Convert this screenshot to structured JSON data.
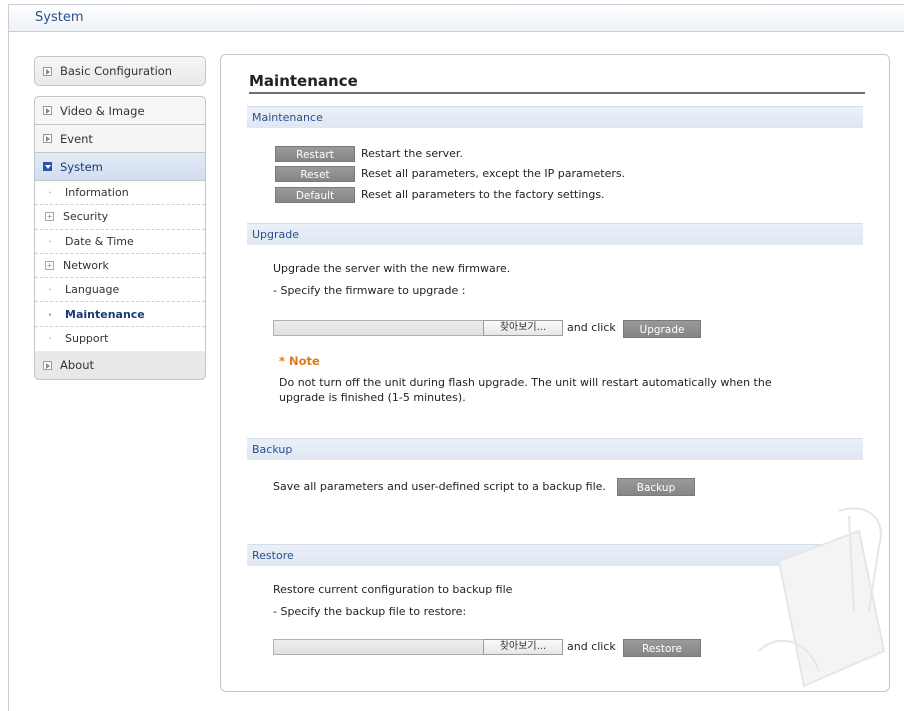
{
  "header": {
    "title": "System"
  },
  "sidebar": {
    "basic_configuration": "Basic Configuration",
    "video_image": "Video & Image",
    "event": "Event",
    "system": "System",
    "system_items": [
      {
        "label": "Information",
        "marker": "dot"
      },
      {
        "label": "Security",
        "marker": "plus"
      },
      {
        "label": "Date & Time",
        "marker": "dot"
      },
      {
        "label": "Network",
        "marker": "plus"
      },
      {
        "label": "Language",
        "marker": "dot"
      },
      {
        "label": "Maintenance",
        "marker": "dot",
        "current": true
      },
      {
        "label": "Support",
        "marker": "dot"
      }
    ],
    "about": "About"
  },
  "main": {
    "title": "Maintenance",
    "maintenance": {
      "header": "Maintenance",
      "restart_btn": "Restart",
      "restart_desc": "Restart the server.",
      "reset_btn": "Reset",
      "reset_desc": "Reset all parameters, except the IP parameters.",
      "default_btn": "Default",
      "default_desc": "Reset all parameters to the factory settings."
    },
    "upgrade": {
      "header": "Upgrade",
      "line1": "Upgrade the server with the new firmware.",
      "line2": "- Specify the firmware to upgrade :",
      "browse_label": "찾아보기...",
      "and_click": "and click",
      "upgrade_btn": "Upgrade",
      "note_title": "* Note",
      "note_text": "Do not turn off the unit during flash upgrade. The unit will restart automatically when the upgrade is finished (1-5 minutes)."
    },
    "backup": {
      "header": "Backup",
      "line": "Save all parameters and user-defined script to a backup file.",
      "backup_btn": "Backup"
    },
    "restore": {
      "header": "Restore",
      "line1": "Restore current configuration to backup file",
      "line2": "- Specify the backup file to restore:",
      "browse_label": "찾아보기...",
      "and_click": "and click",
      "restore_btn": "Restore"
    }
  },
  "colors": {
    "accent_blue": "#2b4f8c",
    "note_orange": "#e07a1c",
    "button_gray": "#8c8c8c",
    "section_bg": "#e4ebf5"
  }
}
